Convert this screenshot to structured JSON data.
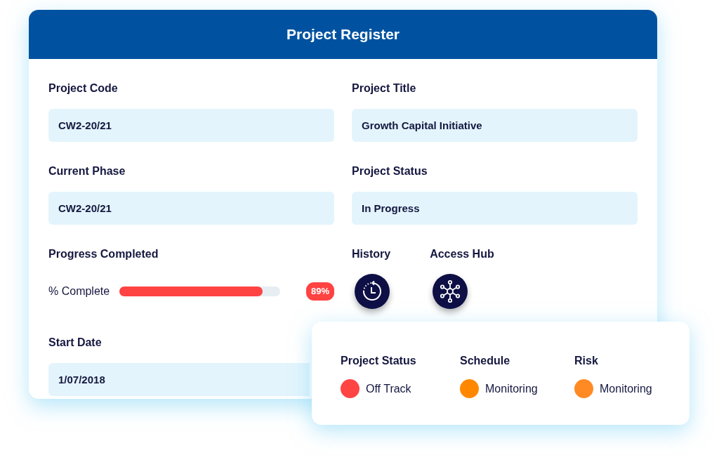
{
  "window": {
    "title": "Project Register"
  },
  "fields": [
    {
      "label": "Project Code",
      "value": "CW2-20/21"
    },
    {
      "label": "Project Title",
      "value": "Growth Capital Initiative"
    },
    {
      "label": "Current Phase",
      "value": "CW2-20/21"
    },
    {
      "label": "Project Status",
      "value": "In Progress"
    }
  ],
  "progress": {
    "heading": "Progress Completed",
    "label": "% Complete",
    "level": 0.89,
    "reading": "89%"
  },
  "actions": [
    {
      "label": "History",
      "kind": "history"
    },
    {
      "label": "Access Hub",
      "kind": "hub"
    }
  ],
  "start_date": {
    "label": "Start Date",
    "value": "1/07/2018"
  },
  "status_panel": [
    {
      "label": "Project Status",
      "value": "Off Track",
      "color": "#ff4444"
    },
    {
      "label": "Schedule",
      "value": "Monitoring",
      "color": "#ff8800"
    },
    {
      "label": "Risk",
      "value": "Monitoring",
      "color": "#ff8a24"
    }
  ]
}
